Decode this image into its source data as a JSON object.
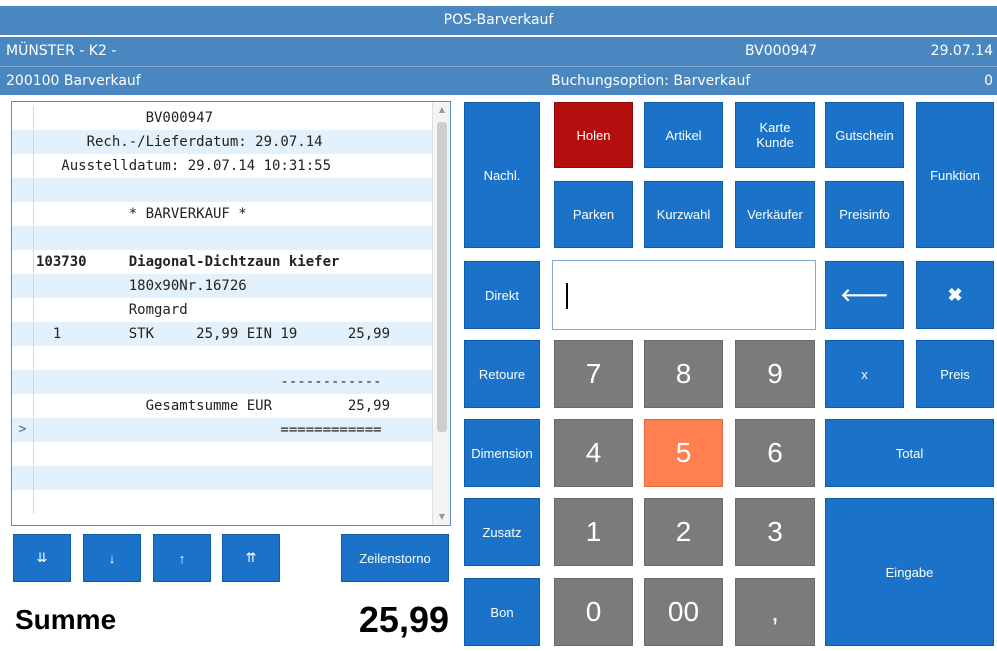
{
  "titlebar": {
    "title": "POS-Barverkauf"
  },
  "header": {
    "location": "MÜNSTER - K2 -",
    "document_no": "BV000947",
    "date": "29.07.14",
    "customer": "200100 Barverkauf",
    "booking_option": "Buchungsoption: Barverkauf",
    "counter": "0"
  },
  "receipt": {
    "rows": [
      {
        "gutter": "",
        "text": "             BV000947"
      },
      {
        "gutter": "",
        "text": "      Rech.-/Lieferdatum: 29.07.14"
      },
      {
        "gutter": "",
        "text": "   Ausstelldatum: 29.07.14 10:31:55"
      },
      {
        "gutter": "",
        "text": ""
      },
      {
        "gutter": "",
        "text": "           * BARVERKAUF *"
      },
      {
        "gutter": "",
        "text": ""
      },
      {
        "gutter": "",
        "text": "103730     Diagonal-Dichtzaun kiefer"
      },
      {
        "gutter": "",
        "text": "           180x90Nr.16726"
      },
      {
        "gutter": "",
        "text": "           Romgard"
      },
      {
        "gutter": "",
        "text": "  1        STK     25,99 EIN 19      25,99"
      },
      {
        "gutter": "",
        "text": ""
      },
      {
        "gutter": "",
        "text": "                             ------------"
      },
      {
        "gutter": "",
        "text": "             Gesamtsumme EUR         25,99"
      },
      {
        "gutter": ">",
        "text": "                             ============"
      },
      {
        "gutter": "",
        "text": ""
      },
      {
        "gutter": "",
        "text": ""
      },
      {
        "gutter": "",
        "text": ""
      }
    ]
  },
  "nav": {
    "bottom": "⇊",
    "down": "↓",
    "up": "↑",
    "top": "⇈",
    "line_cancel": "Zeilenstorno"
  },
  "sum": {
    "label": "Summe",
    "value": "25,99"
  },
  "buttons": {
    "nachl": "Nachl.",
    "holen": "Holen",
    "artikel": "Artikel",
    "karte_kunde_1": "Karte",
    "karte_kunde_2": "Kunde",
    "gutschein": "Gutschein",
    "funktion": "Funktion",
    "parken": "Parken",
    "kurzwahl": "Kurzwahl",
    "verkaeufer": "Verkäufer",
    "preisinfo": "Preisinfo",
    "direkt": "Direkt",
    "backspace": "🡐",
    "clear": "✖",
    "retoure": "Retoure",
    "mult": "x",
    "preis": "Preis",
    "dimension": "Dimension",
    "total": "Total",
    "zusatz": "Zusatz",
    "eingabe": "Eingabe",
    "bon": "Bon"
  },
  "keypad": {
    "k7": "7",
    "k8": "8",
    "k9": "9",
    "k4": "4",
    "k5": "5",
    "k6": "6",
    "k1": "1",
    "k2": "2",
    "k3": "3",
    "k0": "0",
    "k00": "00",
    "kcomma": ","
  },
  "input": {
    "value": ""
  },
  "colors": {
    "header_bar": "#4a86c0",
    "button_blue": "#1a73c9",
    "key_grey": "#7b7b7b",
    "holen_red": "#b50e0e",
    "key_highlight": "#ff7f50",
    "receipt_alt_row": "#e2f1fb"
  }
}
